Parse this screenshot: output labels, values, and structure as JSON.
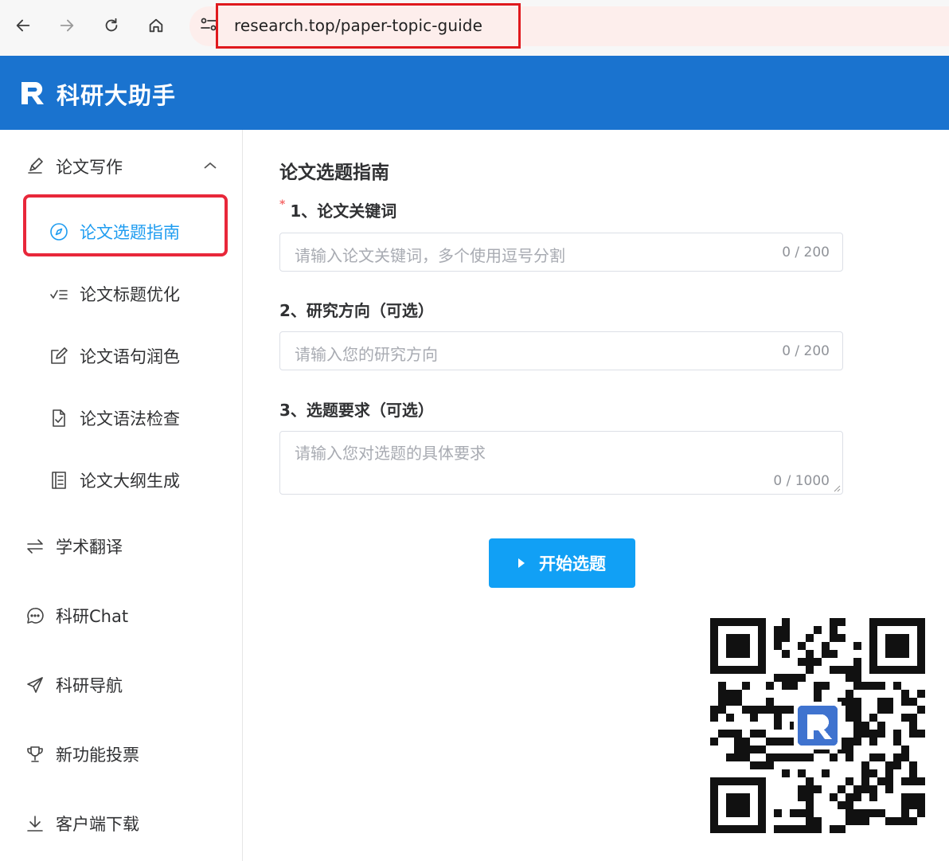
{
  "browser": {
    "url": "research.top/paper-topic-guide"
  },
  "header": {
    "title": "科研大助手"
  },
  "sidebar": {
    "group": {
      "label": "论文写作"
    },
    "sub_items": [
      {
        "label": "论文选题指南",
        "icon": "compass-icon",
        "active": true
      },
      {
        "label": "论文标题优化",
        "icon": "checklist-icon"
      },
      {
        "label": "论文语句润色",
        "icon": "edit-icon"
      },
      {
        "label": "论文语法检查",
        "icon": "document-check-icon"
      },
      {
        "label": "论文大纲生成",
        "icon": "outline-icon"
      }
    ],
    "items": [
      {
        "label": "学术翻译",
        "icon": "translate-icon"
      },
      {
        "label": "科研Chat",
        "icon": "chat-icon"
      },
      {
        "label": "科研导航",
        "icon": "navigation-icon"
      },
      {
        "label": "新功能投票",
        "icon": "trophy-icon"
      },
      {
        "label": "客户端下载",
        "icon": "download-icon"
      }
    ]
  },
  "form": {
    "title": "论文选题指南",
    "fields": [
      {
        "label": "1、论文关键词",
        "required": true,
        "placeholder": "请输入论文关键词，多个使用逗号分割",
        "count": "0 / 200"
      },
      {
        "label": "2、研究方向（可选）",
        "required": false,
        "placeholder": "请输入您的研究方向",
        "count": "0 / 200"
      },
      {
        "label": "3、选题要求（可选）",
        "required": false,
        "placeholder": "请输入您对选题的具体要求",
        "count": "0 / 1000"
      }
    ],
    "submit_label": "开始选题"
  },
  "colors": {
    "header_bg": "#1a73cf",
    "accent": "#1e9cf0",
    "button_bg": "#11a0f5",
    "highlight_border": "#e0191d"
  }
}
